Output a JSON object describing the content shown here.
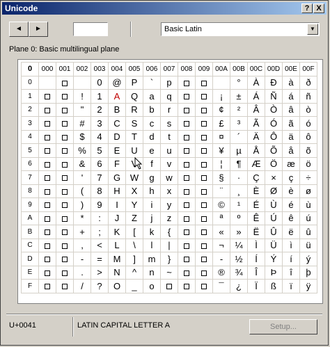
{
  "window": {
    "title": "Unicode"
  },
  "titlebar": {
    "help": "?",
    "close": "X"
  },
  "toolbar": {
    "prev": "◄",
    "next": "►",
    "code_value": ""
  },
  "block_select": {
    "value": "Basic Latin",
    "arrow": "▼"
  },
  "plane_label": "Plane 0: Basic multilingual plane",
  "grid": {
    "corner": "0",
    "col_headers": [
      "000",
      "001",
      "002",
      "003",
      "004",
      "005",
      "006",
      "007",
      "008",
      "009",
      "00A",
      "00B",
      "00C",
      "00D",
      "00E",
      "00F"
    ],
    "row_headers": [
      "0",
      "1",
      "2",
      "3",
      "4",
      "5",
      "6",
      "7",
      "8",
      "9",
      "A",
      "B",
      "C",
      "D",
      "E",
      "F"
    ],
    "rows": [
      [
        "",
        "□",
        "",
        "0",
        "@",
        "P",
        "`",
        "p",
        "□",
        "□",
        "",
        "°",
        "À",
        "Ð",
        "à",
        "ð"
      ],
      [
        "□",
        "□",
        "!",
        "1",
        "A",
        "Q",
        "a",
        "q",
        "□",
        "□",
        "¡",
        "±",
        "Á",
        "Ñ",
        "á",
        "ñ"
      ],
      [
        "□",
        "□",
        "\"",
        "2",
        "B",
        "R",
        "b",
        "r",
        "□",
        "□",
        "¢",
        "²",
        "Â",
        "Ò",
        "â",
        "ò"
      ],
      [
        "□",
        "□",
        "#",
        "3",
        "C",
        "S",
        "c",
        "s",
        "□",
        "□",
        "£",
        "³",
        "Ã",
        "Ó",
        "ã",
        "ó"
      ],
      [
        "□",
        "□",
        "$",
        "4",
        "D",
        "T",
        "d",
        "t",
        "□",
        "□",
        "¤",
        "´",
        "Ä",
        "Ô",
        "ä",
        "ô"
      ],
      [
        "□",
        "□",
        "%",
        "5",
        "E",
        "U",
        "e",
        "u",
        "□",
        "□",
        "¥",
        "µ",
        "Å",
        "Õ",
        "å",
        "õ"
      ],
      [
        "□",
        "□",
        "&",
        "6",
        "F",
        "V",
        "f",
        "v",
        "□",
        "□",
        "¦",
        "¶",
        "Æ",
        "Ö",
        "æ",
        "ö"
      ],
      [
        "□",
        "□",
        "'",
        "7",
        "G",
        "W",
        "g",
        "w",
        "□",
        "□",
        "§",
        "·",
        "Ç",
        "×",
        "ç",
        "÷"
      ],
      [
        "□",
        "□",
        "(",
        "8",
        "H",
        "X",
        "h",
        "x",
        "□",
        "□",
        "¨",
        "¸",
        "È",
        "Ø",
        "è",
        "ø"
      ],
      [
        "□",
        "□",
        ")",
        "9",
        "I",
        "Y",
        "i",
        "y",
        "□",
        "□",
        "©",
        "¹",
        "É",
        "Ù",
        "é",
        "ù"
      ],
      [
        "□",
        "□",
        "*",
        ":",
        "J",
        "Z",
        "j",
        "z",
        "□",
        "□",
        "ª",
        "º",
        "Ê",
        "Ú",
        "ê",
        "ú"
      ],
      [
        "□",
        "□",
        "+",
        ";",
        "K",
        "[",
        "k",
        "{",
        "□",
        "□",
        "«",
        "»",
        "Ë",
        "Û",
        "ë",
        "û"
      ],
      [
        "□",
        "□",
        ",",
        "<",
        "L",
        "\\",
        "l",
        "|",
        "□",
        "□",
        "¬",
        "¼",
        "Ì",
        "Ü",
        "ì",
        "ü"
      ],
      [
        "□",
        "□",
        "-",
        "=",
        "M",
        "]",
        "m",
        "}",
        "□",
        "□",
        "-",
        "½",
        "Í",
        "Ý",
        "í",
        "ý"
      ],
      [
        "□",
        "□",
        ".",
        ">",
        "N",
        "^",
        "n",
        "~",
        "□",
        "□",
        "®",
        "¾",
        "Î",
        "Þ",
        "î",
        "þ"
      ],
      [
        "□",
        "□",
        "/",
        "?",
        "O",
        "_",
        "o",
        "□",
        "□",
        "□",
        "¯",
        "¿",
        "Ï",
        "ß",
        "ï",
        "ÿ"
      ]
    ],
    "selected_row": 1,
    "selected_col": 4
  },
  "status": {
    "code": "U+0041",
    "name": "LATIN CAPITAL LETTER A",
    "setup_label": "Setup..."
  }
}
